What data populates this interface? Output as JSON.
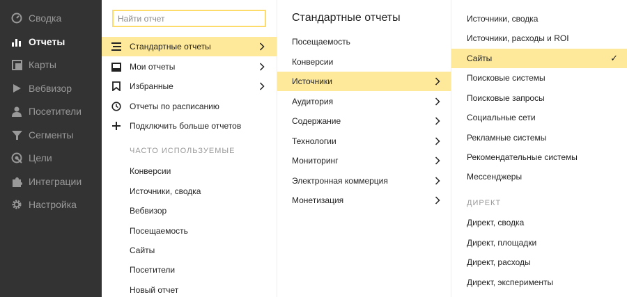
{
  "sidebar": {
    "items": [
      {
        "label": "Сводка",
        "icon": "dashboard-icon"
      },
      {
        "label": "Отчеты",
        "icon": "bar-chart-icon",
        "active": true
      },
      {
        "label": "Карты",
        "icon": "map-icon"
      },
      {
        "label": "Вебвизор",
        "icon": "play-icon"
      },
      {
        "label": "Посетители",
        "icon": "person-icon"
      },
      {
        "label": "Сегменты",
        "icon": "funnel-icon"
      },
      {
        "label": "Цели",
        "icon": "target-icon"
      },
      {
        "label": "Интеграции",
        "icon": "puzzle-icon"
      },
      {
        "label": "Настройка",
        "icon": "gear-icon"
      }
    ]
  },
  "search": {
    "placeholder": "Найти отчет"
  },
  "menu": {
    "items": [
      {
        "label": "Стандартные отчеты",
        "icon": "list-icon",
        "selected": true
      },
      {
        "label": "Мои отчеты",
        "icon": "inbox-icon"
      },
      {
        "label": "Избранные",
        "icon": "bookmark-icon"
      },
      {
        "label": "Отчеты по расписанию",
        "icon": "clock-icon"
      },
      {
        "label": "Подключить больше отчетов",
        "icon": "plus-icon"
      }
    ],
    "frequent_title": "ЧАСТО ИСПОЛЬЗУЕМЫЕ",
    "frequent": [
      "Конверсии",
      "Источники, сводка",
      "Вебвизор",
      "Посещаемость",
      "Сайты",
      "Посетители",
      "Новый отчет"
    ]
  },
  "standard": {
    "title": "Стандартные отчеты",
    "items": [
      {
        "label": "Посещаемость"
      },
      {
        "label": "Конверсии"
      },
      {
        "label": "Источники",
        "selected": true
      },
      {
        "label": "Аудитория"
      },
      {
        "label": "Содержание"
      },
      {
        "label": "Технологии"
      },
      {
        "label": "Мониторинг"
      },
      {
        "label": "Электронная коммерция"
      },
      {
        "label": "Монетизация"
      }
    ]
  },
  "sources": {
    "items": [
      {
        "label": "Источники, сводка"
      },
      {
        "label": "Источники, расходы и ROI"
      },
      {
        "label": "Сайты",
        "selected": true
      },
      {
        "label": "Поисковые системы"
      },
      {
        "label": "Поисковые запросы"
      },
      {
        "label": "Социальные сети"
      },
      {
        "label": "Рекламные системы"
      },
      {
        "label": "Рекомендательные системы"
      },
      {
        "label": "Мессенджеры"
      }
    ],
    "direct_title": "ДИРЕКТ",
    "direct": [
      "Директ, сводка",
      "Директ, площадки",
      "Директ, расходы",
      "Директ, эксперименты"
    ],
    "check": "✓"
  },
  "colors": {
    "sidebar": "#333333",
    "selected": "#fee99a",
    "search_border": "#fddc6c"
  }
}
